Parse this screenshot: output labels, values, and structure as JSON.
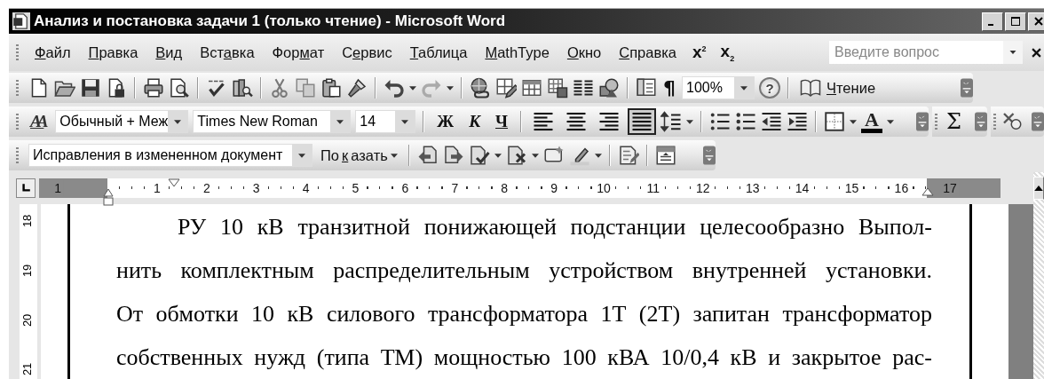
{
  "window": {
    "title": "Анализ и постановка задачи 1 (только чтение) - Microsoft Word"
  },
  "menu": [
    {
      "key": "Ф",
      "end": "айл"
    },
    {
      "key": "П",
      "end": "равка"
    },
    {
      "key": "В",
      "end": "ид"
    },
    {
      "start": "Вст",
      "key": "а",
      "end": "вка"
    },
    {
      "start": "Фор",
      "key": "м",
      "end": "ат"
    },
    {
      "start": "С",
      "key": "е",
      "end": "рвис"
    },
    {
      "key": "Т",
      "end": "аблица"
    },
    {
      "key": "M",
      "end": "athType"
    },
    {
      "key": "О",
      "end": "кно"
    },
    {
      "key": "С",
      "end": "правка"
    }
  ],
  "mathtype_buttons": [
    "x$^{2}$",
    "x$_{2}$"
  ],
  "help_search": {
    "placeholder": "Введите вопрос"
  },
  "standard_toolbar": {
    "show_formatting": "¶",
    "zoom": "100%",
    "help": "?",
    "reading_button": {
      "key": "Ч",
      "end": "тение"
    }
  },
  "formatting_toolbar": {
    "styles_button": "AA",
    "style": "Обычный + Меж",
    "font": "Times New Roman",
    "size": "14",
    "text_format_buttons": [
      {
        "label": "Ж",
        "kind": "bold"
      },
      {
        "label": "К",
        "kind": "italic"
      },
      {
        "label": "Ч",
        "kind": "underline"
      }
    ],
    "alignment": [
      {
        "kind": "left",
        "selected": false
      },
      {
        "kind": "center",
        "selected": false
      },
      {
        "kind": "right",
        "selected": false
      },
      {
        "kind": "justify",
        "selected": true
      }
    ],
    "font_color_button": "A",
    "sum_button": "Σ"
  },
  "reviewing_toolbar": {
    "display": "Исправления в измененном документ",
    "show_menu": {
      "start": "По",
      "key": "к",
      "end": "азать"
    }
  },
  "ruler": {
    "left_margin_labels": [
      "1"
    ],
    "labels": [
      "1",
      "2",
      "3",
      "4",
      "5",
      "6",
      "7",
      "8",
      "9",
      "10",
      "11",
      "12",
      "13",
      "14",
      "15",
      "16"
    ],
    "right_margin_labels": [
      "17"
    ]
  },
  "vertical_ruler": {
    "labels": [
      "18",
      "19",
      "20",
      "21"
    ]
  },
  "document": {
    "lines": [
      "РУ 10 кВ транзитной понижающей подстанции целесообразно Выпол-",
      "нить комплектным распределительным устройством внутренней установки.",
      "От обмотки 10 кВ силового трансформатора 1Т (2Т) запитан трансформатор",
      "собственных нужд (типа ТМ) мощностью 100 кВА 10/0,4 кВ и закрытое рас-"
    ]
  }
}
